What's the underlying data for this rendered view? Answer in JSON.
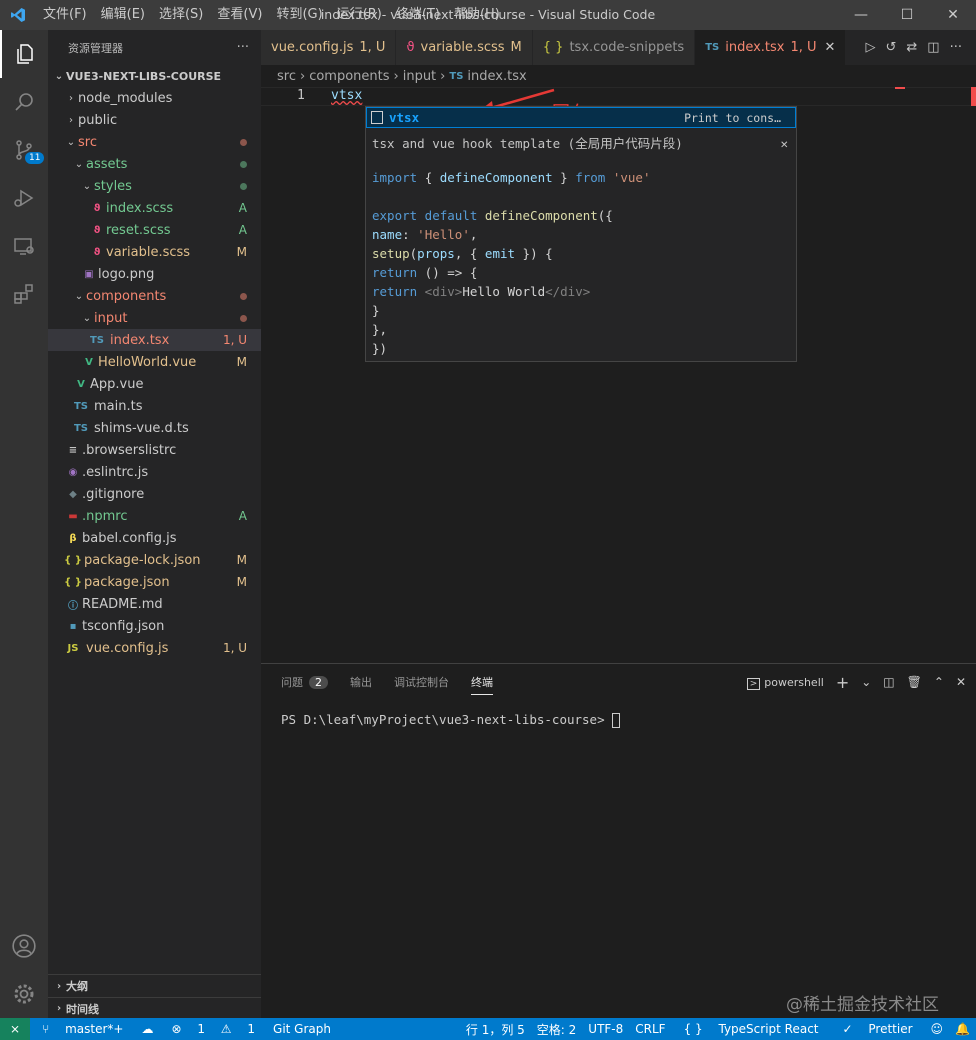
{
  "window": {
    "title": "index.tsx - vue3-next-libs-course - Visual Studio Code"
  },
  "menu": [
    "文件(F)",
    "编辑(E)",
    "选择(S)",
    "查看(V)",
    "转到(G)",
    "运行(R)",
    "终端(T)",
    "帮助(H)"
  ],
  "activity": {
    "scm_badge": "11"
  },
  "explorer": {
    "title": "资源管理器",
    "more": "···",
    "root": "VUE3-NEXT-LIBS-COURSE",
    "items": [
      {
        "label": "node_modules",
        "status": ""
      },
      {
        "label": "public",
        "status": ""
      },
      {
        "label": "src",
        "status": ""
      },
      {
        "label": "assets",
        "status": ""
      },
      {
        "label": "styles",
        "status": ""
      },
      {
        "label": "index.scss",
        "status": "A"
      },
      {
        "label": "reset.scss",
        "status": "A"
      },
      {
        "label": "variable.scss",
        "status": "M"
      },
      {
        "label": "logo.png",
        "status": ""
      },
      {
        "label": "components",
        "status": ""
      },
      {
        "label": "input",
        "status": ""
      },
      {
        "label": "index.tsx",
        "status": "1, U"
      },
      {
        "label": "HelloWorld.vue",
        "status": "M"
      },
      {
        "label": "App.vue",
        "status": ""
      },
      {
        "label": "main.ts",
        "status": ""
      },
      {
        "label": "shims-vue.d.ts",
        "status": ""
      },
      {
        "label": ".browserslistrc",
        "status": ""
      },
      {
        "label": ".eslintrc.js",
        "status": ""
      },
      {
        "label": ".gitignore",
        "status": ""
      },
      {
        "label": ".npmrc",
        "status": "A"
      },
      {
        "label": "babel.config.js",
        "status": ""
      },
      {
        "label": "package-lock.json",
        "status": "M"
      },
      {
        "label": "package.json",
        "status": "M"
      },
      {
        "label": "README.md",
        "status": ""
      },
      {
        "label": "tsconfig.json",
        "status": ""
      },
      {
        "label": "vue.config.js",
        "status": "1, U"
      }
    ],
    "icons": {
      "ts": "TS",
      "js": "JS",
      "json": "{ }"
    },
    "outline": "大纲",
    "timeline": "时间线"
  },
  "tabs": [
    {
      "label": "vue.config.js",
      "status": "1, U"
    },
    {
      "label": "variable.scss",
      "status": "M"
    },
    {
      "label": "tsx.code-snippets",
      "status": ""
    },
    {
      "label": "index.tsx",
      "status": "1, U"
    }
  ],
  "breadcrumb": [
    "src",
    "components",
    "input",
    "index.tsx"
  ],
  "editor": {
    "line_number": "1",
    "code": "vtsx"
  },
  "annotation": "回车",
  "suggest": {
    "item": "vtsx",
    "detail": "Print to cons…",
    "doc_title": "tsx and vue hook template (全局用户代码片段)",
    "code": {
      "l1": {
        "a": "import",
        "b": "{ ",
        "c": "defineComponent",
        "d": " } ",
        "e": "from",
        "f": "'vue'"
      },
      "l2": {
        "a": "export",
        "b": " default ",
        "c": "defineComponent",
        "d": "({"
      },
      "l3": {
        "a": "name",
        "b": ": ",
        "c": "'Hello'",
        "d": ","
      },
      "l4": {
        "a": "setup",
        "b": "(",
        "c": "props",
        "d": ", { ",
        "e": "emit",
        "f": " }) {"
      },
      "l5": {
        "a": "return",
        "b": " () => {"
      },
      "l6": {
        "a": "return",
        "b": " <div>",
        "c": "Hello World",
        "d": "</div>"
      },
      "l7": "}",
      "l8": "},",
      "l9": "})"
    }
  },
  "panel": {
    "tabs": [
      "问题",
      "输出",
      "调试控制台",
      "终端"
    ],
    "problems_count": "2",
    "shell": "powershell",
    "prompt": "PS D:\\leaf\\myProject\\vue3-next-libs-course> "
  },
  "statusbar": {
    "branch": "master*+",
    "errors": "1",
    "warnings": "1",
    "gitgraph": "Git Graph",
    "position": "行 1，列 5",
    "spaces": "空格: 2",
    "encoding": "UTF-8",
    "eol": "CRLF",
    "language": "TypeScript React",
    "prettier": "Prettier"
  },
  "watermark": "@稀土掘金技术社区",
  "colors": {
    "accent": "#007acc",
    "modified": "#e2c08d",
    "untracked": "#73c991",
    "error": "#f14c4c"
  }
}
